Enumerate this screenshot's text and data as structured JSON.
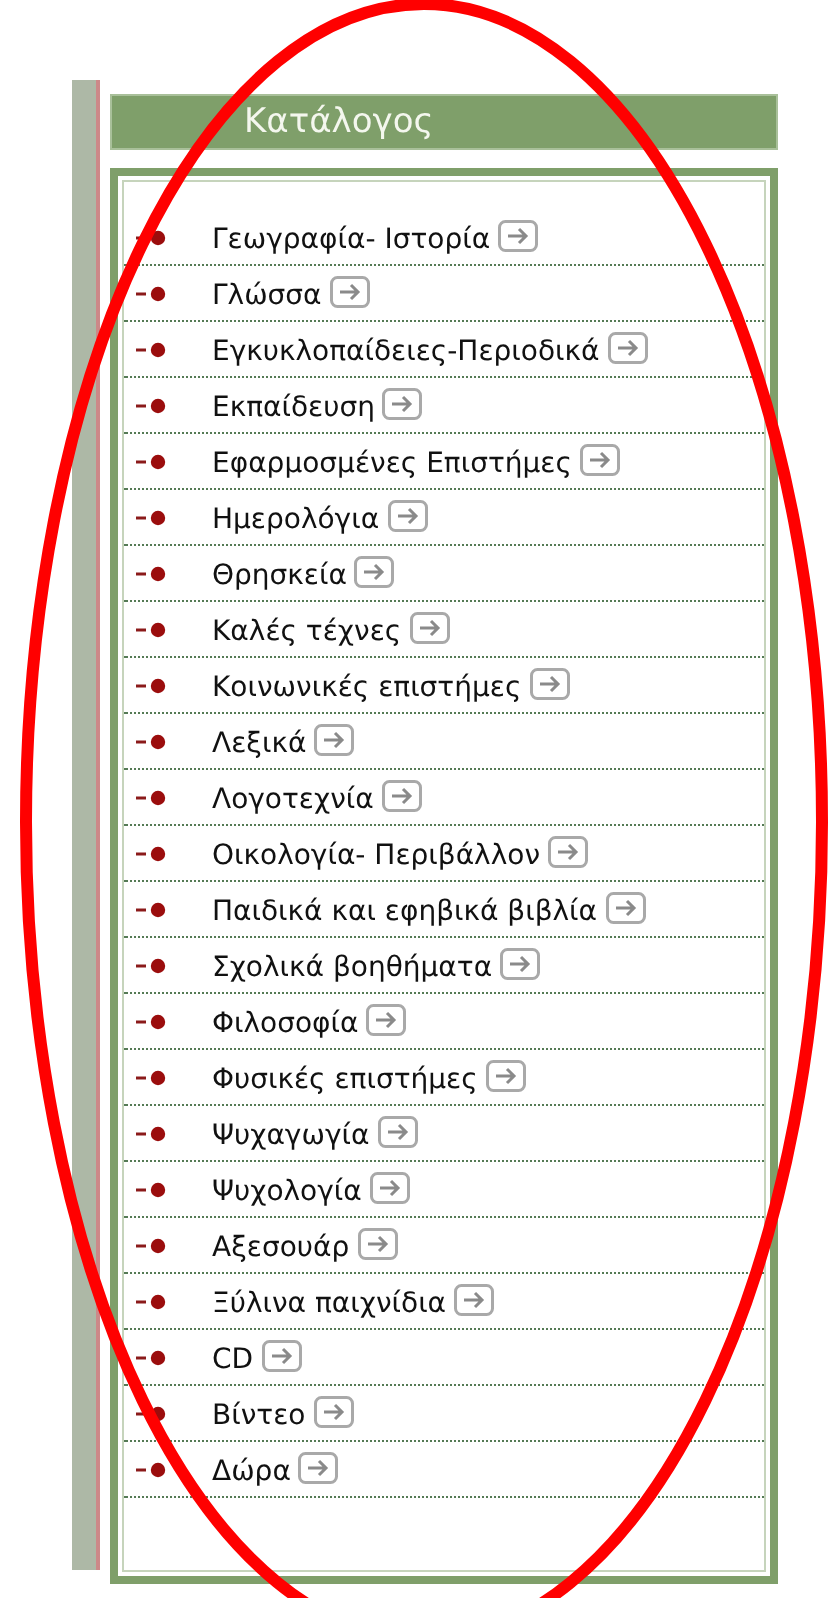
{
  "catalog": {
    "title": "Κατάλογος",
    "items": [
      {
        "label": "Γεωγραφία- Ιστορία"
      },
      {
        "label": "Γλώσσα"
      },
      {
        "label": "Εγκυκλοπαίδειες-Περιοδικά"
      },
      {
        "label": "Εκπαίδευση"
      },
      {
        "label": "Εφαρμοσμένες Επιστήμες"
      },
      {
        "label": "Ημερολόγια"
      },
      {
        "label": "Θρησκεία"
      },
      {
        "label": "Καλές τέχνες"
      },
      {
        "label": "Κοινωνικές επιστήμες"
      },
      {
        "label": "Λεξικά"
      },
      {
        "label": "Λογοτεχνία"
      },
      {
        "label": "Οικολογία- Περιβάλλον"
      },
      {
        "label": "Παιδικά και εφηβικά βιβλία"
      },
      {
        "label": "Σχολικά βοηθήματα"
      },
      {
        "label": "Φιλοσοφία"
      },
      {
        "label": "Φυσικές επιστήμες"
      },
      {
        "label": "Ψυχαγωγία"
      },
      {
        "label": "Ψυχολογία"
      },
      {
        "label": "Αξεσουάρ"
      },
      {
        "label": "Ξύλινα παιχνίδια"
      },
      {
        "label": "CD"
      },
      {
        "label": "Βίντεο"
      },
      {
        "label": "Δώρα"
      }
    ]
  }
}
